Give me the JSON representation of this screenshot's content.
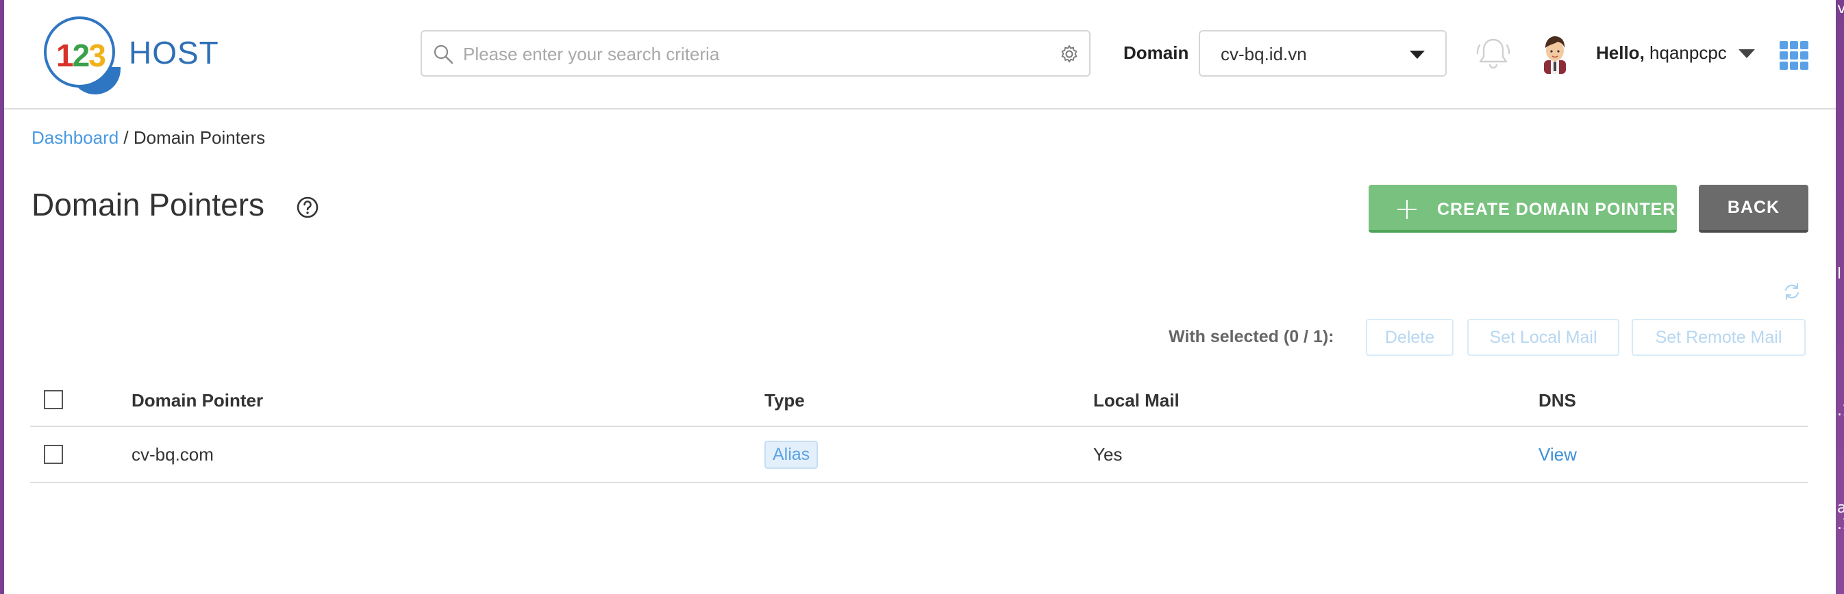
{
  "brand": {
    "logo_digits": [
      "1",
      "2",
      "3"
    ],
    "logo_text": "HOST"
  },
  "search": {
    "placeholder": "Please enter your search criteria",
    "value": ""
  },
  "domain": {
    "label": "Domain",
    "selected": "cv-bq.id.vn"
  },
  "user": {
    "greeting": "Hello,",
    "username": "hqanpcpc"
  },
  "breadcrumb": {
    "home": "Dashboard",
    "separator": " / ",
    "current": "Domain Pointers"
  },
  "page": {
    "title": "Domain Pointers"
  },
  "actions": {
    "create_label": "CREATE DOMAIN POINTER",
    "back_label": "BACK"
  },
  "selection": {
    "label": "With selected (0 / 1):",
    "delete": "Delete",
    "set_local_mail": "Set Local Mail",
    "set_remote_mail": "Set Remote Mail"
  },
  "table": {
    "headers": {
      "pointer": "Domain Pointer",
      "type": "Type",
      "local_mail": "Local Mail",
      "dns": "DNS"
    },
    "rows": [
      {
        "pointer": "cv-bq.com",
        "type": "Alias",
        "local_mail": "Yes",
        "dns": "View"
      }
    ]
  },
  "colors": {
    "accent_blue": "#4a9ae0",
    "create_green": "#79c17f",
    "back_gray": "#6b6b6b",
    "logo_blue": "#2f6fb6"
  },
  "icons": [
    "search-icon",
    "gear-icon",
    "bell-icon",
    "avatar",
    "apps-grid-icon",
    "help-icon",
    "plus-icon",
    "refresh-icon",
    "chevron-down-icon"
  ]
}
